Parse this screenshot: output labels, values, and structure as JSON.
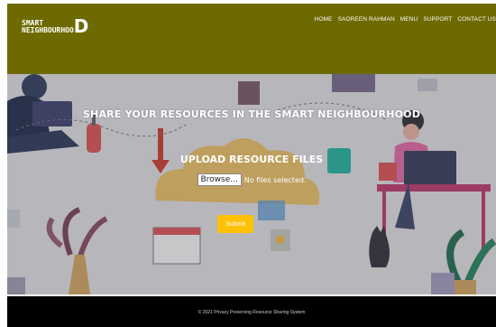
{
  "header": {
    "logo": {
      "line1": "SMART",
      "line2": "NEIGHBOURHOO",
      "big_letter": "D"
    },
    "nav": [
      {
        "label": "HOME"
      },
      {
        "label": "SAOREEN RAHMAN"
      },
      {
        "label": "MENU"
      },
      {
        "label": "SUPPORT"
      },
      {
        "label": "CONTACT US"
      }
    ],
    "background_color": "#6c6a00"
  },
  "hero": {
    "title": "SHARE YOUR RESOURCES IN THE SMART NEIGHBOURHOOD",
    "upload_title": "UPLOAD RESOURCE FILES",
    "browse_label": "Browse...",
    "file_status": "No files selected.",
    "submit_label": "Submit",
    "submit_color": "#ffc107"
  },
  "footer": {
    "copyright": "© 2021 Privacy Preserving Resource Sharing System"
  }
}
